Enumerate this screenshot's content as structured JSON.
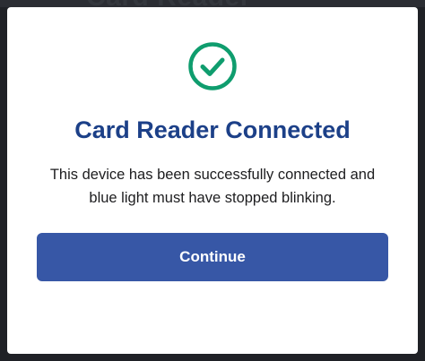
{
  "background": {
    "title": "Card Reader"
  },
  "dialog": {
    "icon": "check-circle-icon",
    "title": "Card Reader Connected",
    "message": "This device has been successfully connected and blue light must have stopped blinking.",
    "continue_label": "Continue"
  },
  "colors": {
    "success": "#0f9d6e",
    "title": "#1c4088",
    "button": "#3757a6",
    "overlay": "#1f2126"
  }
}
